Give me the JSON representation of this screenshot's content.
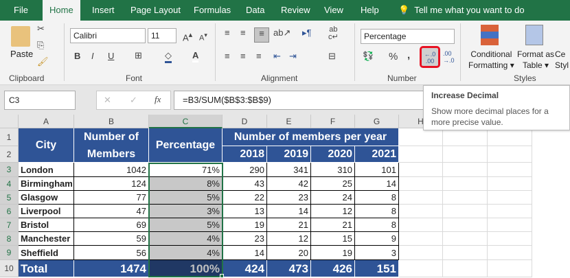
{
  "tabs": [
    "File",
    "Home",
    "Insert",
    "Page Layout",
    "Formulas",
    "Data",
    "Review",
    "View",
    "Help"
  ],
  "tell_me": "Tell me what you want to do",
  "ribbon": {
    "clipboard": {
      "label": "Clipboard",
      "paste": "Paste"
    },
    "font": {
      "label": "Font",
      "name": "Calibri",
      "size": "11",
      "bold": "B",
      "italic": "I",
      "underline": "U"
    },
    "alignment": {
      "label": "Alignment"
    },
    "number": {
      "label": "Number",
      "format": "Percentage",
      "percent": "%",
      "comma": ",",
      "increase_decimal": "←.0 .00",
      "decrease_decimal": ".00 →.0"
    },
    "styles": {
      "label": "Styles",
      "conditional": [
        "Conditional",
        "Formatting"
      ],
      "format_table": [
        "Format as",
        "Table"
      ],
      "cell_styles": [
        "Ce",
        "Styl"
      ]
    }
  },
  "formula_bar": {
    "name_box": "C3",
    "fx": "fx",
    "formula": "=B3/SUM($B$3:$B$9)"
  },
  "tooltip": {
    "title": "Increase Decimal",
    "body": "Show more decimal places for a more precise value."
  },
  "columns": [
    "A",
    "B",
    "C",
    "D",
    "E",
    "F",
    "G",
    "H"
  ],
  "rows": [
    "1",
    "2",
    "3",
    "4",
    "5",
    "6",
    "7",
    "8",
    "9",
    "10"
  ],
  "header": {
    "city": "City",
    "members": "Number of Members",
    "percentage": "Percentage",
    "per_year": "Number of members per year",
    "years": [
      "2018",
      "2019",
      "2020",
      "2021"
    ]
  },
  "data": [
    [
      "London",
      "1042",
      "71%",
      "290",
      "341",
      "310",
      "101"
    ],
    [
      "Birmingham",
      "124",
      "8%",
      "43",
      "42",
      "25",
      "14"
    ],
    [
      "Glasgow",
      "77",
      "5%",
      "22",
      "23",
      "24",
      "8"
    ],
    [
      "Liverpool",
      "47",
      "3%",
      "13",
      "14",
      "12",
      "8"
    ],
    [
      "Bristol",
      "69",
      "5%",
      "19",
      "21",
      "21",
      "8"
    ],
    [
      "Manchester",
      "59",
      "4%",
      "23",
      "12",
      "15",
      "9"
    ],
    [
      "Sheffield",
      "56",
      "4%",
      "14",
      "20",
      "19",
      "3"
    ]
  ],
  "total": [
    "Total",
    "1474",
    "100%",
    "424",
    "473",
    "426",
    "151"
  ],
  "colors": {
    "tab_bar": "#217346",
    "header_fill": "#2f5496",
    "selection": "#217346",
    "highlight": "#e81123"
  }
}
